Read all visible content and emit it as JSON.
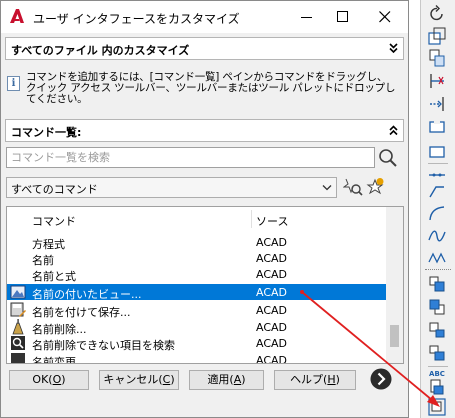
{
  "dialog": {
    "title": "ユーザ インタフェースをカスタマイズ",
    "customize_header": "すべてのファイル 内のカスタマイズ",
    "info_text": "コマンドを追加するには、[コマンド一覧] ペインからコマンドをドラッグし、\nクイック アクセス ツールバー、ツールバーまたはツール パレットにドロップし\nてください。",
    "command_list_header": "コマンド一覧:",
    "search_placeholder": "コマンド一覧を検索",
    "filter_value": "すべてのコマンド",
    "columns": {
      "command": "コマンド",
      "source": "ソース"
    },
    "rows": [
      {
        "name": "方程式",
        "source": "ACAD",
        "icon": "none"
      },
      {
        "name": "名前",
        "source": "ACAD",
        "icon": "none"
      },
      {
        "name": "名前と式",
        "source": "ACAD",
        "icon": "none"
      },
      {
        "name": "名前の付いたビュー...",
        "source": "ACAD",
        "icon": "named-view-icon",
        "selected": true
      },
      {
        "name": "名前を付けて保存...",
        "source": "ACAD",
        "icon": "save-as-icon"
      },
      {
        "name": "名前削除...",
        "source": "ACAD",
        "icon": "purge-icon"
      },
      {
        "name": "名前削除できない項目を検索",
        "source": "ACAD",
        "icon": "find-non-purgeable-icon"
      },
      {
        "name": "名前変更",
        "source": "ACAD",
        "icon": "rename-icon"
      }
    ],
    "buttons": {
      "ok": "OK(",
      "ok_key": "O",
      "cancel": "キャンセル(",
      "cancel_key": "C",
      "apply": "適用(",
      "apply_key": "A",
      "help": "ヘルプ(",
      "help_key": "H",
      "close_paren": ")"
    },
    "colors": {
      "selection": "#0078d7",
      "logo": "#c8102e",
      "annotation_arrow": "#e02020"
    }
  },
  "toolbar": {
    "icons": [
      "rotate-icon",
      "scale-icon",
      "copy-icon",
      "trim-icon",
      "extend-icon",
      "break-icon",
      "join-icon",
      "chamfer-icon",
      "fillet-icon",
      "blend-icon",
      "spline-icon",
      "draw-order-front-icon",
      "draw-order-back-icon",
      "draw-order-above-icon",
      "draw-order-below-icon",
      "text-front-icon",
      "spell-check-icon",
      "selected-draw-order-icon"
    ],
    "abc_label": "ABC"
  }
}
